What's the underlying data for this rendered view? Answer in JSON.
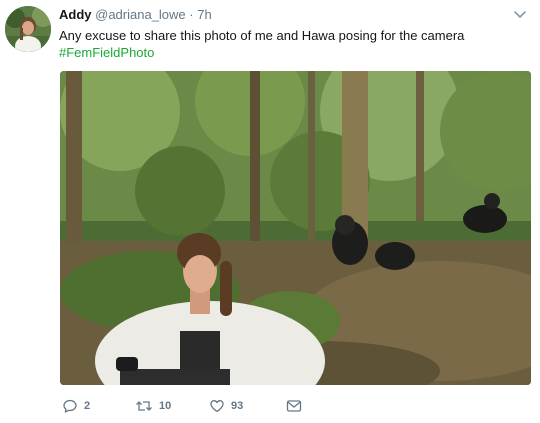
{
  "tweet": {
    "author": {
      "display_name": "Addy",
      "handle": "@adriana_lowe",
      "separator": "·",
      "time": "7h"
    },
    "text": "Any excuse to share this photo of me and Hawa posing for the camera",
    "hashtag": "#FemFieldPhoto",
    "photo_icon": "photo-woman-with-chimpanzees-in-forest",
    "actions": {
      "reply": {
        "icon": "reply-icon",
        "count": "2"
      },
      "retweet": {
        "icon": "retweet-icon",
        "count": "10"
      },
      "like": {
        "icon": "heart-icon",
        "count": "93"
      },
      "message": {
        "icon": "envelope-icon"
      }
    },
    "menu_icon": "chevron-down-icon"
  },
  "colors": {
    "text": "#14171a",
    "muted": "#657786",
    "hashtag": "#1da838"
  }
}
